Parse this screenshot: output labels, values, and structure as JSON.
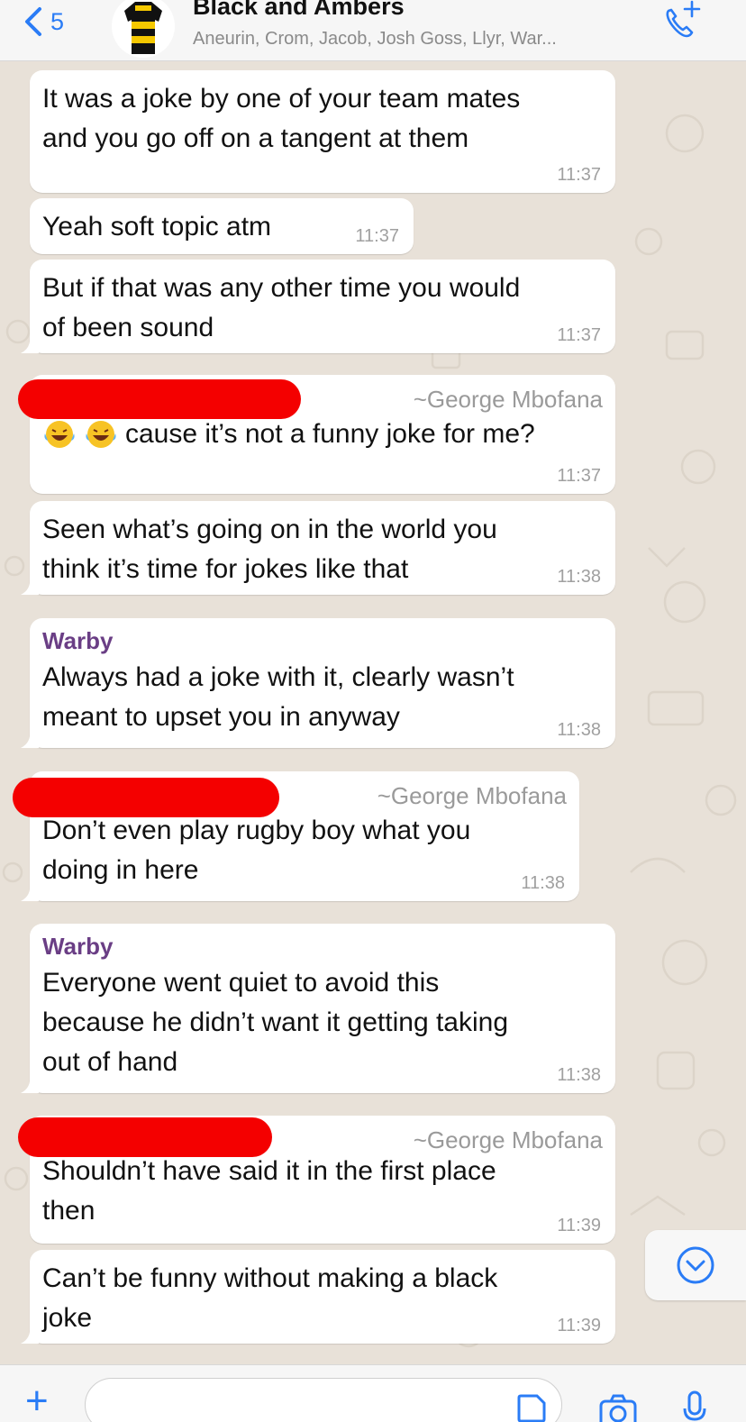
{
  "header": {
    "back_count": "5",
    "title": "Black and Ambers",
    "subtitle": "Aneurin, Crom, Jacob, Josh Goss, Llyr, War..."
  },
  "messages": [
    {
      "text": "It was a joke by one of your team mates\nand you go off on a tangent at them",
      "time": "11:37"
    },
    {
      "text": "Yeah soft topic atm",
      "time": "11:37"
    },
    {
      "text": "But if that was any other time you would\nof been sound",
      "time": "11:37"
    },
    {
      "sender_right": "~George Mbofana",
      "text": "cause it’s not a funny joke for me?",
      "time": "11:37"
    },
    {
      "text": "Seen what’s going on in the world you\nthink it’s time for jokes like that",
      "time": "11:38"
    },
    {
      "sender": "Warby",
      "text": "Always had a joke with it, clearly wasn’t\nmeant to upset you in anyway",
      "time": "11:38"
    },
    {
      "sender_right": "~George Mbofana",
      "text": "Don’t even play rugby boy what you\ndoing in here",
      "time": "11:38"
    },
    {
      "sender": "Warby",
      "text": "Everyone went quiet to avoid this\nbecause he didn’t want it getting taking\nout of hand",
      "time": "11:38"
    },
    {
      "sender_right": "~George Mbofana",
      "text": "Shouldn’t have said it in the first place\nthen",
      "time": "11:39"
    },
    {
      "text": "Can’t be funny without making a black\njoke",
      "time": "11:39"
    }
  ],
  "colors": {
    "accent": "#2a7cf6",
    "sender_name": "#6a3e85",
    "redaction": "#f40000",
    "background": "#e8e1d8"
  },
  "icons": [
    "chevron-left-icon",
    "group-avatar-icon",
    "add-call-icon",
    "laughing-emoji-icon",
    "scroll-down-icon",
    "plus-icon",
    "sticker-icon",
    "camera-icon",
    "microphone-icon"
  ]
}
